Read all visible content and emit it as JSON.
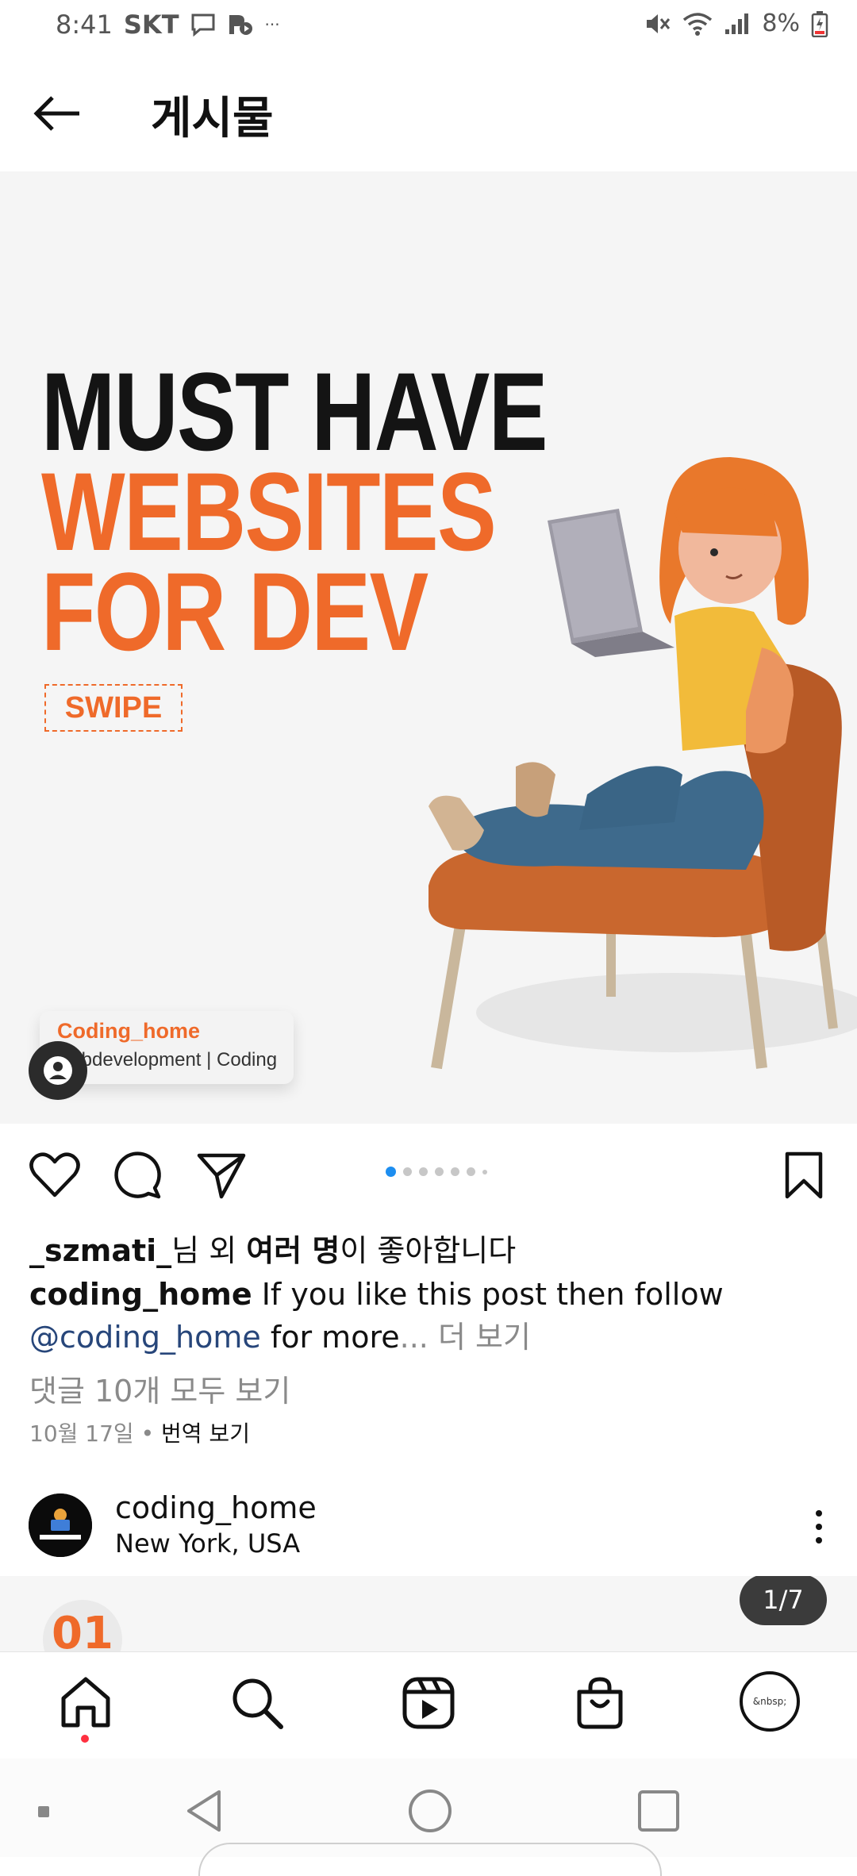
{
  "status_bar": {
    "time": "8:41",
    "carrier": "SKT",
    "overflow": "···",
    "battery": "8%"
  },
  "header": {
    "title": "게시물"
  },
  "post": {
    "headline": [
      "MUST HAVE",
      "WEBSITES",
      "FOR DEV"
    ],
    "swipe": "SWIPE",
    "brand_name": "Coding_home",
    "brand_sub": "webdevelopment | Coding",
    "carousel_count": 7,
    "carousel_active": 1
  },
  "likes": {
    "user": "_szmati_",
    "mid": "님 외 ",
    "others": "여러 명",
    "suffix": "이 좋아합니다"
  },
  "caption": {
    "user": "coding_home",
    "text": " If you like this post then follow",
    "mention": "@coding_home",
    "rest": " for more",
    "ellipsis": "...",
    "more": " 더 보기"
  },
  "comments": "댓글 10개 모두 보기",
  "date_row": {
    "date": "10월 17일",
    "dot": " • ",
    "translate": "번역 보기"
  },
  "next_post": {
    "username": "coding_home",
    "location": "New York, USA",
    "counter": "1/7",
    "preview_number": "01"
  },
  "bottom_nav": {
    "profile_text": "&nbsp;"
  },
  "colors": {
    "accent": "#ef6a2a",
    "link": "#27467a",
    "pager_active": "#1d8ef0",
    "notification": "#ff3040"
  }
}
